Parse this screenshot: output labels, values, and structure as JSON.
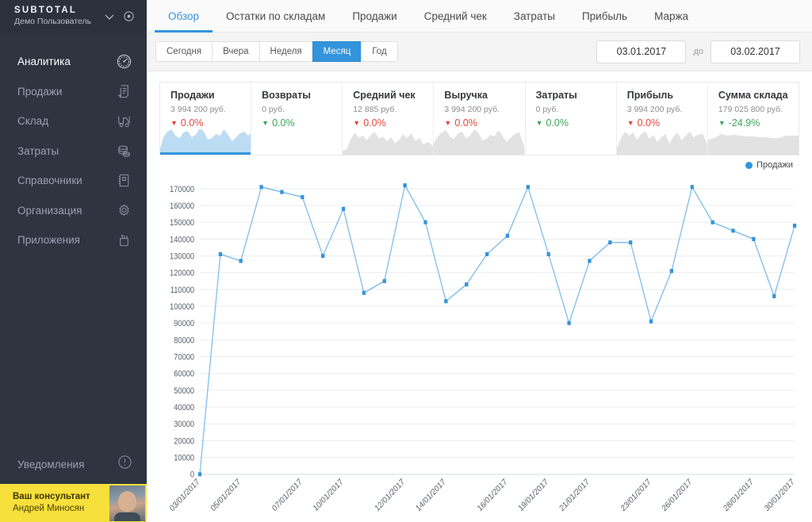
{
  "sidebar": {
    "brand": "SUBTOTAL",
    "user": "Демо Пользователь",
    "chevron_icon": "chevron-down-icon",
    "gear_icon": "target-icon",
    "items": [
      {
        "label": "Аналитика",
        "icon": "speedometer-icon",
        "active": true
      },
      {
        "label": "Продажи",
        "icon": "receipt-icon",
        "active": false
      },
      {
        "label": "Склад",
        "icon": "forklift-icon",
        "active": false
      },
      {
        "label": "Затраты",
        "icon": "coins-icon",
        "active": false
      },
      {
        "label": "Справочники",
        "icon": "notebook-icon",
        "active": false
      },
      {
        "label": "Организация",
        "icon": "gear-icon",
        "active": false
      },
      {
        "label": "Приложения",
        "icon": "toolcup-icon",
        "active": false
      }
    ],
    "notifications": {
      "label": "Уведомления",
      "icon": "alert-circle-icon"
    },
    "consultant": {
      "title": "Ваш консультант",
      "name": "Андрей Миносян"
    }
  },
  "topbar": {
    "tabs": [
      {
        "label": "Обзор",
        "active": true
      },
      {
        "label": "Остатки по складам",
        "active": false
      },
      {
        "label": "Продажи",
        "active": false
      },
      {
        "label": "Средний чек",
        "active": false
      },
      {
        "label": "Затраты",
        "active": false
      },
      {
        "label": "Прибыль",
        "active": false
      },
      {
        "label": "Маржа",
        "active": false
      }
    ]
  },
  "filters": {
    "periods": [
      {
        "label": "Сегодня",
        "active": false
      },
      {
        "label": "Вчера",
        "active": false
      },
      {
        "label": "Неделя",
        "active": false
      },
      {
        "label": "Месяц",
        "active": true
      },
      {
        "label": "Год",
        "active": false
      }
    ],
    "date_from": "03.01.2017",
    "date_to": "03.02.2017",
    "separator": "до"
  },
  "kpis": [
    {
      "title": "Продажи",
      "value": "3 994 200 руб.",
      "delta": "0.0%",
      "direction": "down",
      "active": true
    },
    {
      "title": "Возвраты",
      "value": "0 руб.",
      "delta": "0.0%",
      "direction": "up",
      "active": false
    },
    {
      "title": "Средний чек",
      "value": "12 885 руб.",
      "delta": "0.0%",
      "direction": "down",
      "active": false
    },
    {
      "title": "Выручка",
      "value": "3 994 200 руб.",
      "delta": "0.0%",
      "direction": "down",
      "active": false
    },
    {
      "title": "Затраты",
      "value": "0 руб.",
      "delta": "0.0%",
      "direction": "up",
      "active": false
    },
    {
      "title": "Прибыль",
      "value": "3 994 200 руб.",
      "delta": "0.0%",
      "direction": "down",
      "active": false
    },
    {
      "title": "Сумма склада",
      "value": "179 025 800 руб.",
      "delta": "-24.9%",
      "direction": "up",
      "active": false
    }
  ],
  "colors": {
    "accent": "#3394dc",
    "positive": "#3aa757",
    "negative": "#e8453c",
    "sidebar_bg": "#2e3440",
    "consultant_bg": "#f7e03c"
  },
  "chart_data": {
    "type": "line",
    "title": "",
    "xlabel": "",
    "ylabel": "",
    "legend": [
      "Продажи"
    ],
    "legend_position": "top-right",
    "grid": true,
    "ylim": [
      0,
      175000
    ],
    "yticks": [
      0,
      10000,
      20000,
      30000,
      40000,
      50000,
      60000,
      70000,
      80000,
      90000,
      100000,
      110000,
      120000,
      130000,
      140000,
      150000,
      160000,
      170000
    ],
    "ytick_labels": [
      "0",
      "10000",
      "20000",
      "30000",
      "40000",
      "50000",
      "60000",
      "70000",
      "80000",
      "90000",
      "100000",
      "110000",
      "120000",
      "130000",
      "140000",
      "150000",
      "160000",
      "170000"
    ],
    "xtick_labels": [
      "03/01/2017",
      "05/01/2017",
      "07/01/2017",
      "10/01/2017",
      "12/01/2017",
      "14/01/2017",
      "16/01/2017",
      "19/01/2017",
      "21/01/2017",
      "23/01/2017",
      "26/01/2017",
      "28/01/2017",
      "30/01/2017"
    ],
    "x": [
      "03/01/2017",
      "04/01/2017",
      "05/01/2017",
      "06/01/2017",
      "07/01/2017",
      "08/01/2017",
      "09/01/2017",
      "10/01/2017",
      "11/01/2017",
      "12/01/2017",
      "13/01/2017",
      "14/01/2017",
      "15/01/2017",
      "16/01/2017",
      "17/01/2017",
      "18/01/2017",
      "19/01/2017",
      "20/01/2017",
      "21/01/2017",
      "22/01/2017",
      "23/01/2017",
      "24/01/2017",
      "25/01/2017",
      "26/01/2017",
      "27/01/2017",
      "28/01/2017",
      "29/01/2017",
      "30/01/2017"
    ],
    "series": [
      {
        "name": "Продажи",
        "color": "#3394dc",
        "values": [
          0,
          131000,
          127000,
          171000,
          168000,
          165000,
          130000,
          158000,
          108000,
          115000,
          172000,
          150000,
          103000,
          113000,
          131000,
          142000,
          171000,
          131000,
          90000,
          127000,
          138000,
          138000,
          91000,
          121000,
          171000,
          150000,
          145000,
          140000,
          106000,
          148000
        ]
      }
    ]
  }
}
